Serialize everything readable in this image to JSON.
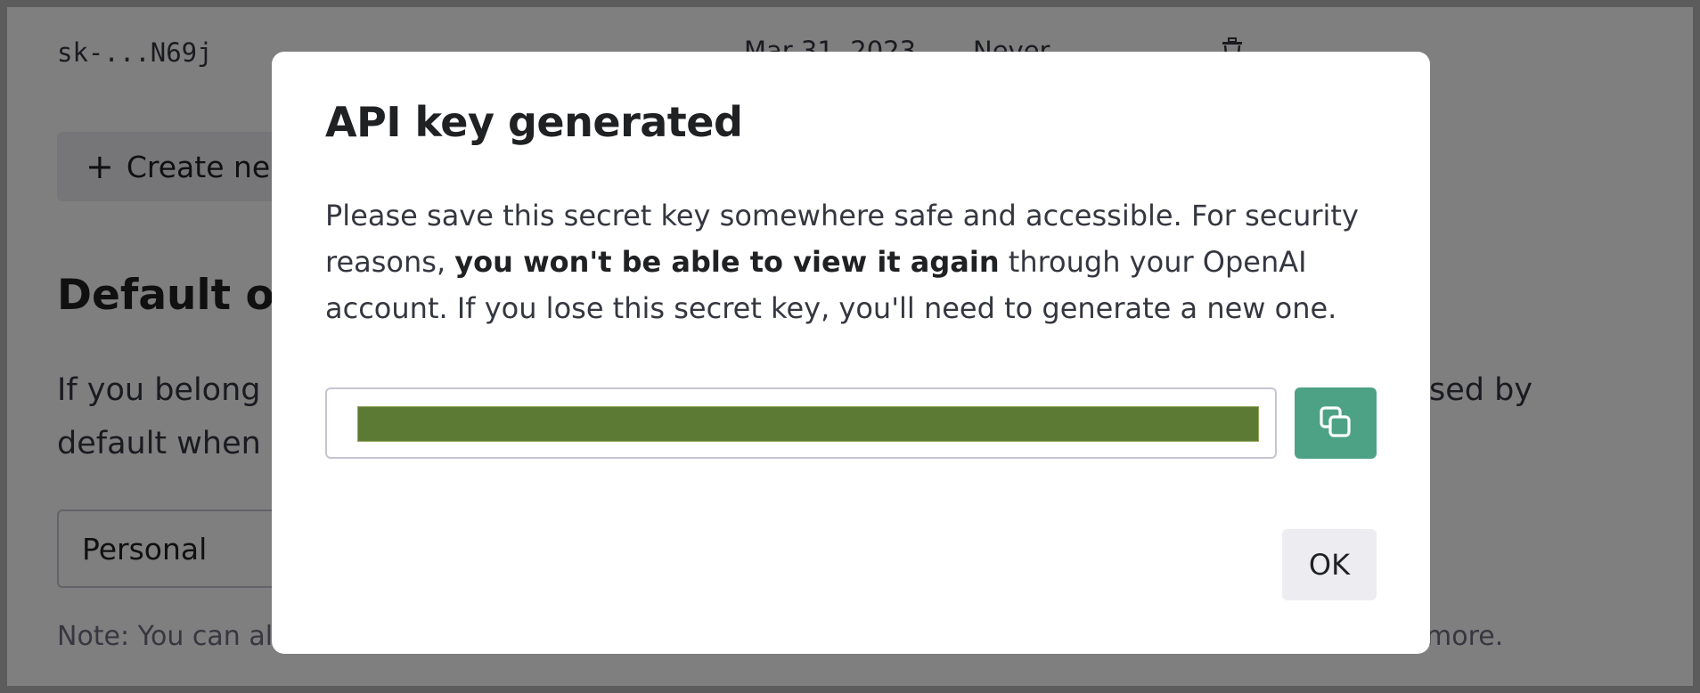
{
  "background": {
    "key_row": {
      "key": "sk-...N69j",
      "created": "Mar 31, 2023",
      "last_used": "Never",
      "delete_icon": "trash-icon"
    },
    "create_button": {
      "icon": "plus-icon",
      "label": "Create ne"
    },
    "org_heading": "Default org",
    "org_paragraph_line1_start": "If you belong",
    "org_paragraph_line1_end": "sed by",
    "org_paragraph_line2_start": "default when",
    "org_select_value": "Personal",
    "note_start": "Note: You can al",
    "note_end": "more."
  },
  "modal": {
    "title": "API key generated",
    "description": {
      "before": "Please save this secret key somewhere safe and accessible. For security reasons, ",
      "bold": "you won't be able to view it again",
      "after": " through your OpenAI account. If you lose this secret key, you'll need to generate a new one."
    },
    "secret_key_field": {
      "redaction_color": "#5d7a35"
    },
    "copy_button": {
      "icon": "copy-icon",
      "color": "#4da286"
    },
    "ok_label": "OK"
  }
}
